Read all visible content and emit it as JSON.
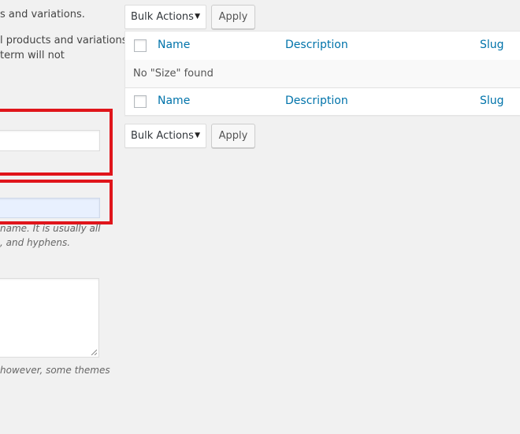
{
  "left_panel": {
    "help_line_1": "s and variations.",
    "help_line_2": "l products and variations",
    "help_line_3": "term will not",
    "slug_help_1": "name. It is usually all",
    "slug_help_2": ", and hyphens.",
    "description_help": "however, some themes",
    "name_input": {
      "value": ""
    },
    "slug_input": {
      "value": ""
    },
    "description_input": {
      "value": ""
    }
  },
  "top_actions": {
    "bulk_label": "Bulk Actions",
    "apply_label": "Apply"
  },
  "bottom_actions": {
    "bulk_label": "Bulk Actions",
    "apply_label": "Apply"
  },
  "table": {
    "columns": [
      "Name",
      "Description",
      "Slug"
    ],
    "empty_message": "No \"Size\" found"
  },
  "colors": {
    "link": "#0073aa",
    "highlight": "#e0151b",
    "focus_fill": "#e8f0fe"
  }
}
